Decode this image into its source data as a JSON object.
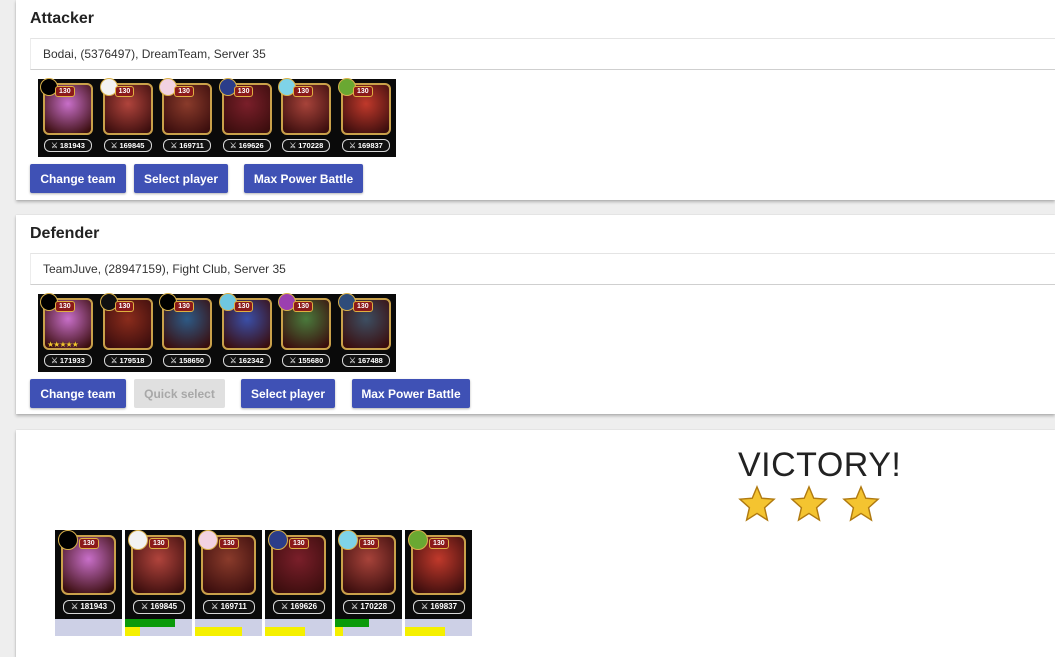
{
  "attacker": {
    "title": "Attacker",
    "player": "Bodai, (5376497), DreamTeam, Server 35",
    "heroes": [
      {
        "level": "130",
        "power": "181943",
        "stars": "",
        "color": "#c86fc9",
        "emblem": "#000000"
      },
      {
        "level": "130",
        "power": "169845",
        "stars": "",
        "color": "#b0443c",
        "emblem": "#f2f2f2"
      },
      {
        "level": "130",
        "power": "169711",
        "stars": "",
        "color": "#8a3b2b",
        "emblem": "#f2d2e2"
      },
      {
        "level": "130",
        "power": "169626",
        "stars": "",
        "color": "#7a1f2a",
        "emblem": "#2b3d8a"
      },
      {
        "level": "130",
        "power": "170228",
        "stars": "",
        "color": "#a7433a",
        "emblem": "#7fd3e8"
      },
      {
        "level": "130",
        "power": "169837",
        "stars": "",
        "color": "#c0392b",
        "emblem": "#6aa832"
      }
    ],
    "buttons": {
      "change_team": "Change team",
      "select_player": "Select player",
      "max_power": "Max Power Battle"
    }
  },
  "defender": {
    "title": "Defender",
    "player": "TeamJuve, (28947159), Fight Club, Server 35",
    "heroes": [
      {
        "level": "130",
        "power": "171933",
        "stars": "★★★★★",
        "color": "#c86fc9",
        "emblem": "#000000"
      },
      {
        "level": "130",
        "power": "179518",
        "stars": "",
        "color": "#8b2c1c",
        "emblem": "#111111"
      },
      {
        "level": "130",
        "power": "158650",
        "stars": "",
        "color": "#2d5a86",
        "emblem": "#000000"
      },
      {
        "level": "130",
        "power": "162342",
        "stars": "",
        "color": "#3a4fa8",
        "emblem": "#6fc7e0"
      },
      {
        "level": "130",
        "power": "155680",
        "stars": "",
        "color": "#4a7a3c",
        "emblem": "#9b3fb0"
      },
      {
        "level": "130",
        "power": "167488",
        "stars": "",
        "color": "#3d4f63",
        "emblem": "#2e4c7a"
      }
    ],
    "buttons": {
      "change_team": "Change team",
      "quick_select": "Quick select",
      "select_player": "Select player",
      "max_power": "Max Power Battle"
    }
  },
  "result": {
    "text": "VICTORY!",
    "stars": 3,
    "heroes": [
      {
        "level": "130",
        "power": "181943",
        "color": "#c86fc9",
        "emblem": "#000000",
        "hp": 0,
        "energy": 0
      },
      {
        "level": "130",
        "power": "169845",
        "color": "#b0443c",
        "emblem": "#f2f2f2",
        "hp": 0.75,
        "energy": 0.22
      },
      {
        "level": "130",
        "power": "169711",
        "color": "#8a3b2b",
        "emblem": "#f2d2e2",
        "hp": 0,
        "energy": 0.7
      },
      {
        "level": "130",
        "power": "169626",
        "color": "#7a1f2a",
        "emblem": "#2b3d8a",
        "hp": 0,
        "energy": 0.6
      },
      {
        "level": "130",
        "power": "170228",
        "color": "#a7433a",
        "emblem": "#7fd3e8",
        "hp": 0.5,
        "energy": 0.12
      },
      {
        "level": "130",
        "power": "169837",
        "color": "#c0392b",
        "emblem": "#6aa832",
        "hp": 0,
        "energy": 0.6
      }
    ]
  },
  "colors": {
    "primary": "#3f51b5",
    "hp": "#0a9a0a",
    "energy": "#f5f000",
    "star": "#f4c430"
  }
}
